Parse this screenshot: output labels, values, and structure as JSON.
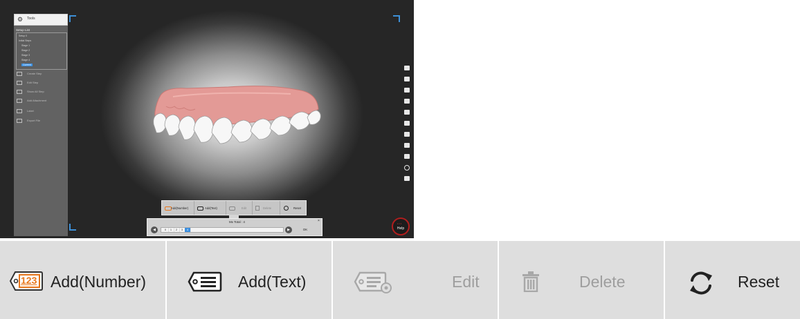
{
  "app": {
    "tools_title": "Tools",
    "setup_list_title": "Setup List",
    "setup_items": [
      "Setup 0",
      "Initial Steps",
      "Stage 1",
      "Stage 2",
      "Stage 3",
      "Stage 4",
      "Current"
    ],
    "menu": [
      {
        "label": "Create Step",
        "icon": "create-step-icon"
      },
      {
        "label": "Edit Step",
        "icon": "edit-step-icon"
      },
      {
        "label": "Show All Step",
        "icon": "show-all-icon"
      },
      {
        "label": "Add Attachment",
        "icon": "attachment-icon"
      },
      {
        "label": "Label",
        "icon": "label-icon"
      },
      {
        "label": "Export File",
        "icon": "export-icon"
      }
    ],
    "mini_toolbar": {
      "add_number": "Add(Number)",
      "add_text": "Add(Text)",
      "edit": "Edit",
      "delete": "Delete",
      "reset": "Reset"
    },
    "step_panel": {
      "total_label": "Mx Total : 4",
      "cells": [
        "0",
        "1",
        "2",
        "3",
        "4"
      ],
      "active_index": 4,
      "ok_label": "OK",
      "close_label": "×"
    },
    "help_label": "Help"
  },
  "toolbar": {
    "add_number_badge": "123",
    "add_number": "Add(Number)",
    "add_text": "Add(Text)",
    "edit": "Edit",
    "delete": "Delete",
    "reset": "Reset",
    "colors": {
      "badge_orange": "#e8771c",
      "enabled_text": "#222222",
      "disabled_text": "#9e9e9e",
      "background": "#dedede"
    }
  }
}
